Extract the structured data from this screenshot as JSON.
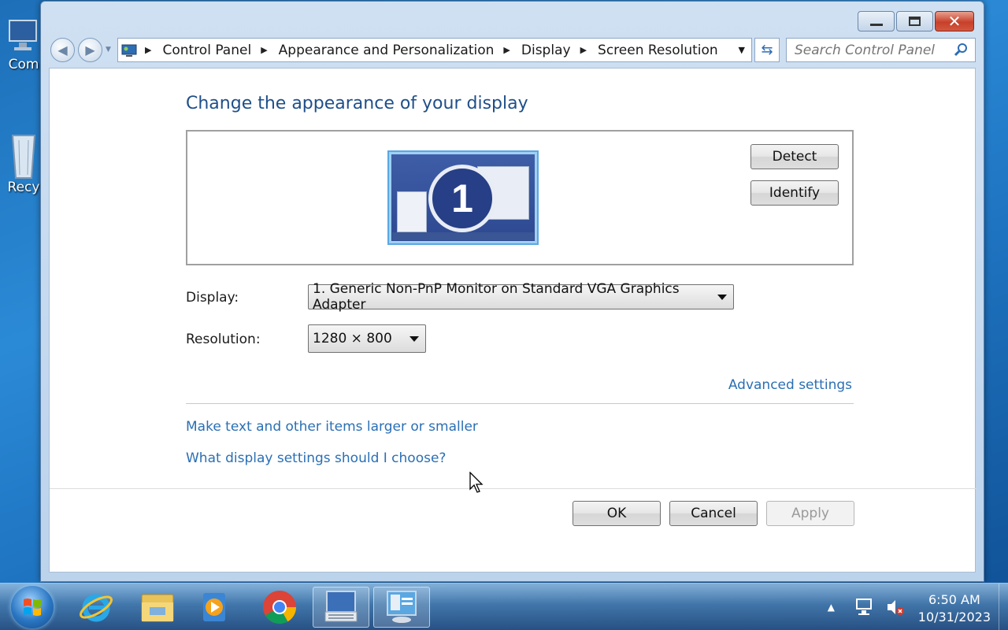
{
  "desktop": {
    "icons": [
      {
        "label": "Com"
      },
      {
        "label": "Recy"
      }
    ]
  },
  "window": {
    "controls": {
      "minimize": "minimize",
      "maximize": "maximize",
      "close": "close"
    },
    "breadcrumb": [
      "Control Panel",
      "Appearance and Personalization",
      "Display",
      "Screen Resolution"
    ],
    "search_placeholder": "Search Control Panel"
  },
  "page": {
    "title": "Change the appearance of your display",
    "monitor_number": "1",
    "detect_label": "Detect",
    "identify_label": "Identify",
    "display_label": "Display:",
    "display_value": "1. Generic Non-PnP Monitor on Standard VGA Graphics Adapter",
    "resolution_label": "Resolution:",
    "resolution_value": "1280 × 800",
    "advanced_link": "Advanced settings",
    "link_text_size": "Make text and other items larger or smaller",
    "link_help": "What display settings should I choose?",
    "ok_label": "OK",
    "cancel_label": "Cancel",
    "apply_label": "Apply"
  },
  "taskbar": {
    "items": [
      "start-button",
      "internet-explorer-icon",
      "file-explorer-icon",
      "media-player-icon",
      "chrome-icon",
      "on-screen-keyboard-icon",
      "screen-resolution-icon"
    ],
    "clock_time": "6:50 AM",
    "clock_date": "10/31/2023"
  }
}
